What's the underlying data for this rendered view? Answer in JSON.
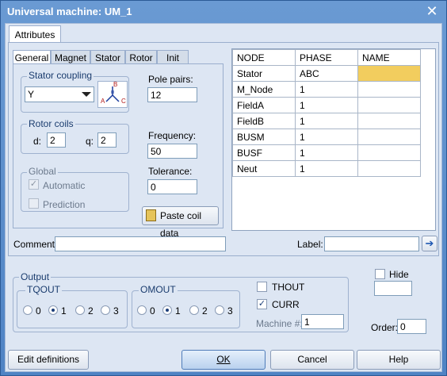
{
  "window": {
    "title": "Universal machine: UM_1"
  },
  "tabs": {
    "attributes": "Attributes"
  },
  "subtabs": [
    "General",
    "Magnet",
    "Stator",
    "Rotor",
    "Init"
  ],
  "stator_coupling": {
    "label": "Stator coupling",
    "value": "Y",
    "diagram_labels": [
      "B",
      "A",
      "C"
    ]
  },
  "pole_pairs": {
    "label": "Pole pairs:",
    "value": "12"
  },
  "rotor_coils": {
    "label": "Rotor coils",
    "d_label": "d:",
    "d_value": "2",
    "q_label": "q:",
    "q_value": "2"
  },
  "frequency": {
    "label": "Frequency:",
    "value": "50"
  },
  "tolerance": {
    "label": "Tolerance:",
    "value": "0"
  },
  "global": {
    "label": "Global",
    "automatic": "Automatic",
    "prediction": "Prediction"
  },
  "paste_button": "Paste coil data",
  "table": {
    "headers": [
      "NODE",
      "PHASE",
      "NAME"
    ],
    "rows": [
      [
        "Stator",
        "ABC",
        ""
      ],
      [
        "M_Node",
        "1",
        ""
      ],
      [
        "FieldA",
        "1",
        ""
      ],
      [
        "FieldB",
        "1",
        ""
      ],
      [
        "BUSM",
        "1",
        ""
      ],
      [
        "BUSF",
        "1",
        ""
      ],
      [
        "Neut",
        "1",
        ""
      ]
    ]
  },
  "comment": {
    "label": "Comment:",
    "value": ""
  },
  "label_field": {
    "label": "Label:",
    "value": ""
  },
  "output": {
    "label": "Output",
    "tqout": "TQOUT",
    "omout": "OMOUT",
    "options": [
      "0",
      "1",
      "2",
      "3"
    ],
    "thout": "THOUT",
    "curr": "CURR",
    "machine_label": "Machine #:",
    "machine_value": "1"
  },
  "hide": {
    "label": "Hide",
    "value": ""
  },
  "order": {
    "label": "Order:",
    "value": "0"
  },
  "buttons": {
    "edit": "Edit definitions",
    "ok": "OK",
    "cancel": "Cancel",
    "help": "Help"
  }
}
